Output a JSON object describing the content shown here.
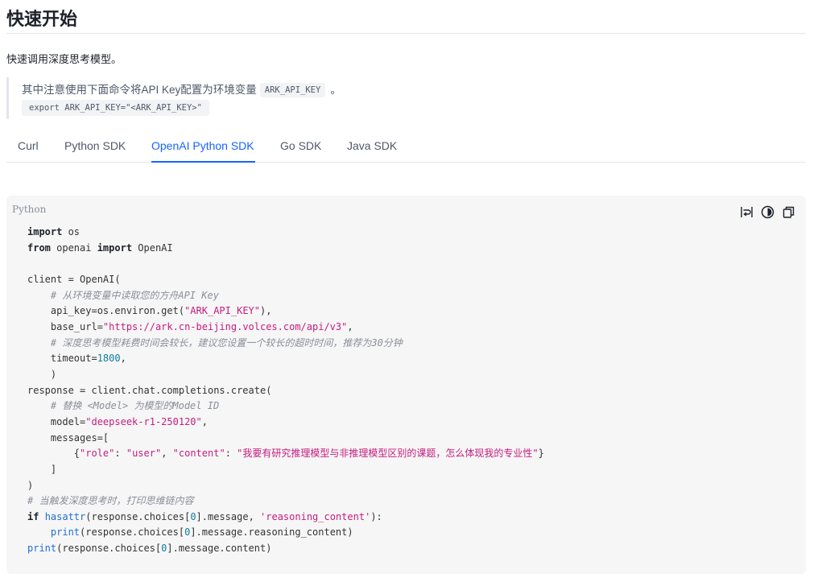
{
  "page": {
    "title": "快速开始",
    "intro": "快速调用深度思考模型。"
  },
  "note": {
    "text": "其中注意使用下面命令将API Key配置为环境变量",
    "env_var": "ARK_API_KEY",
    "suffix": "。",
    "command": "export ARK_API_KEY=\"<ARK_API_KEY>\""
  },
  "tabs": [
    {
      "label": "Curl",
      "active": false
    },
    {
      "label": "Python SDK",
      "active": false
    },
    {
      "label": "OpenAI Python SDK",
      "active": true
    },
    {
      "label": "Go SDK",
      "active": false
    },
    {
      "label": "Java SDK",
      "active": false
    }
  ],
  "code_block": {
    "language": "Python",
    "toolbar_icons": [
      "wrap-lines-icon",
      "theme-toggle-icon",
      "copy-icon"
    ],
    "lines": [
      [
        {
          "t": "import",
          "k": "kw"
        },
        {
          "t": " os"
        }
      ],
      [
        {
          "t": "from",
          "k": "kw"
        },
        {
          "t": " openai "
        },
        {
          "t": "import",
          "k": "kw"
        },
        {
          "t": " OpenAI"
        }
      ],
      [],
      [
        {
          "t": "client = OpenAI("
        }
      ],
      [
        {
          "t": "    # 从环境变量中读取您的方舟API Key",
          "k": "cm"
        }
      ],
      [
        {
          "t": "    api_key=os.environ.get("
        },
        {
          "t": "\"ARK_API_KEY\"",
          "k": "st"
        },
        {
          "t": "),"
        }
      ],
      [
        {
          "t": "    base_url="
        },
        {
          "t": "\"https://ark.cn-beijing.volces.com/api/v3\"",
          "k": "st"
        },
        {
          "t": ","
        }
      ],
      [
        {
          "t": "    # 深度思考模型耗费时间会较长，建议您设置一个较长的超时时间，推荐为30分钟",
          "k": "cm"
        }
      ],
      [
        {
          "t": "    timeout="
        },
        {
          "t": "1800",
          "k": "nu"
        },
        {
          "t": ","
        }
      ],
      [
        {
          "t": "    )"
        }
      ],
      [
        {
          "t": "response = client.chat.completions.create("
        }
      ],
      [
        {
          "t": "    # 替换 <Model> 为模型的Model ID",
          "k": "cm"
        }
      ],
      [
        {
          "t": "    model="
        },
        {
          "t": "\"deepseek-r1-250120\"",
          "k": "st"
        },
        {
          "t": ","
        }
      ],
      [
        {
          "t": "    messages=["
        }
      ],
      [
        {
          "t": "        {"
        },
        {
          "t": "\"role\"",
          "k": "st"
        },
        {
          "t": ": "
        },
        {
          "t": "\"user\"",
          "k": "st"
        },
        {
          "t": ", "
        },
        {
          "t": "\"content\"",
          "k": "st"
        },
        {
          "t": ": "
        },
        {
          "t": "\"我要有研究推理模型与非推理模型区别的课题，怎么体现我的专业性\"",
          "k": "st"
        },
        {
          "t": "}"
        }
      ],
      [
        {
          "t": "    ]"
        }
      ],
      [
        {
          "t": ")"
        }
      ],
      [
        {
          "t": "# 当触发深度思考时，打印思维链内容",
          "k": "cm"
        }
      ],
      [
        {
          "t": "if",
          "k": "kw"
        },
        {
          "t": " "
        },
        {
          "t": "hasattr",
          "k": "bi"
        },
        {
          "t": "(response.choices["
        },
        {
          "t": "0",
          "k": "nu"
        },
        {
          "t": "].message, "
        },
        {
          "t": "'reasoning_content'",
          "k": "st"
        },
        {
          "t": "):"
        }
      ],
      [
        {
          "t": "    "
        },
        {
          "t": "print",
          "k": "bi"
        },
        {
          "t": "(response.choices["
        },
        {
          "t": "0",
          "k": "nu"
        },
        {
          "t": "].message.reasoning_content)"
        }
      ],
      [
        {
          "t": "print",
          "k": "bi"
        },
        {
          "t": "(response.choices["
        },
        {
          "t": "0",
          "k": "nu"
        },
        {
          "t": "].message.content)"
        }
      ]
    ]
  }
}
